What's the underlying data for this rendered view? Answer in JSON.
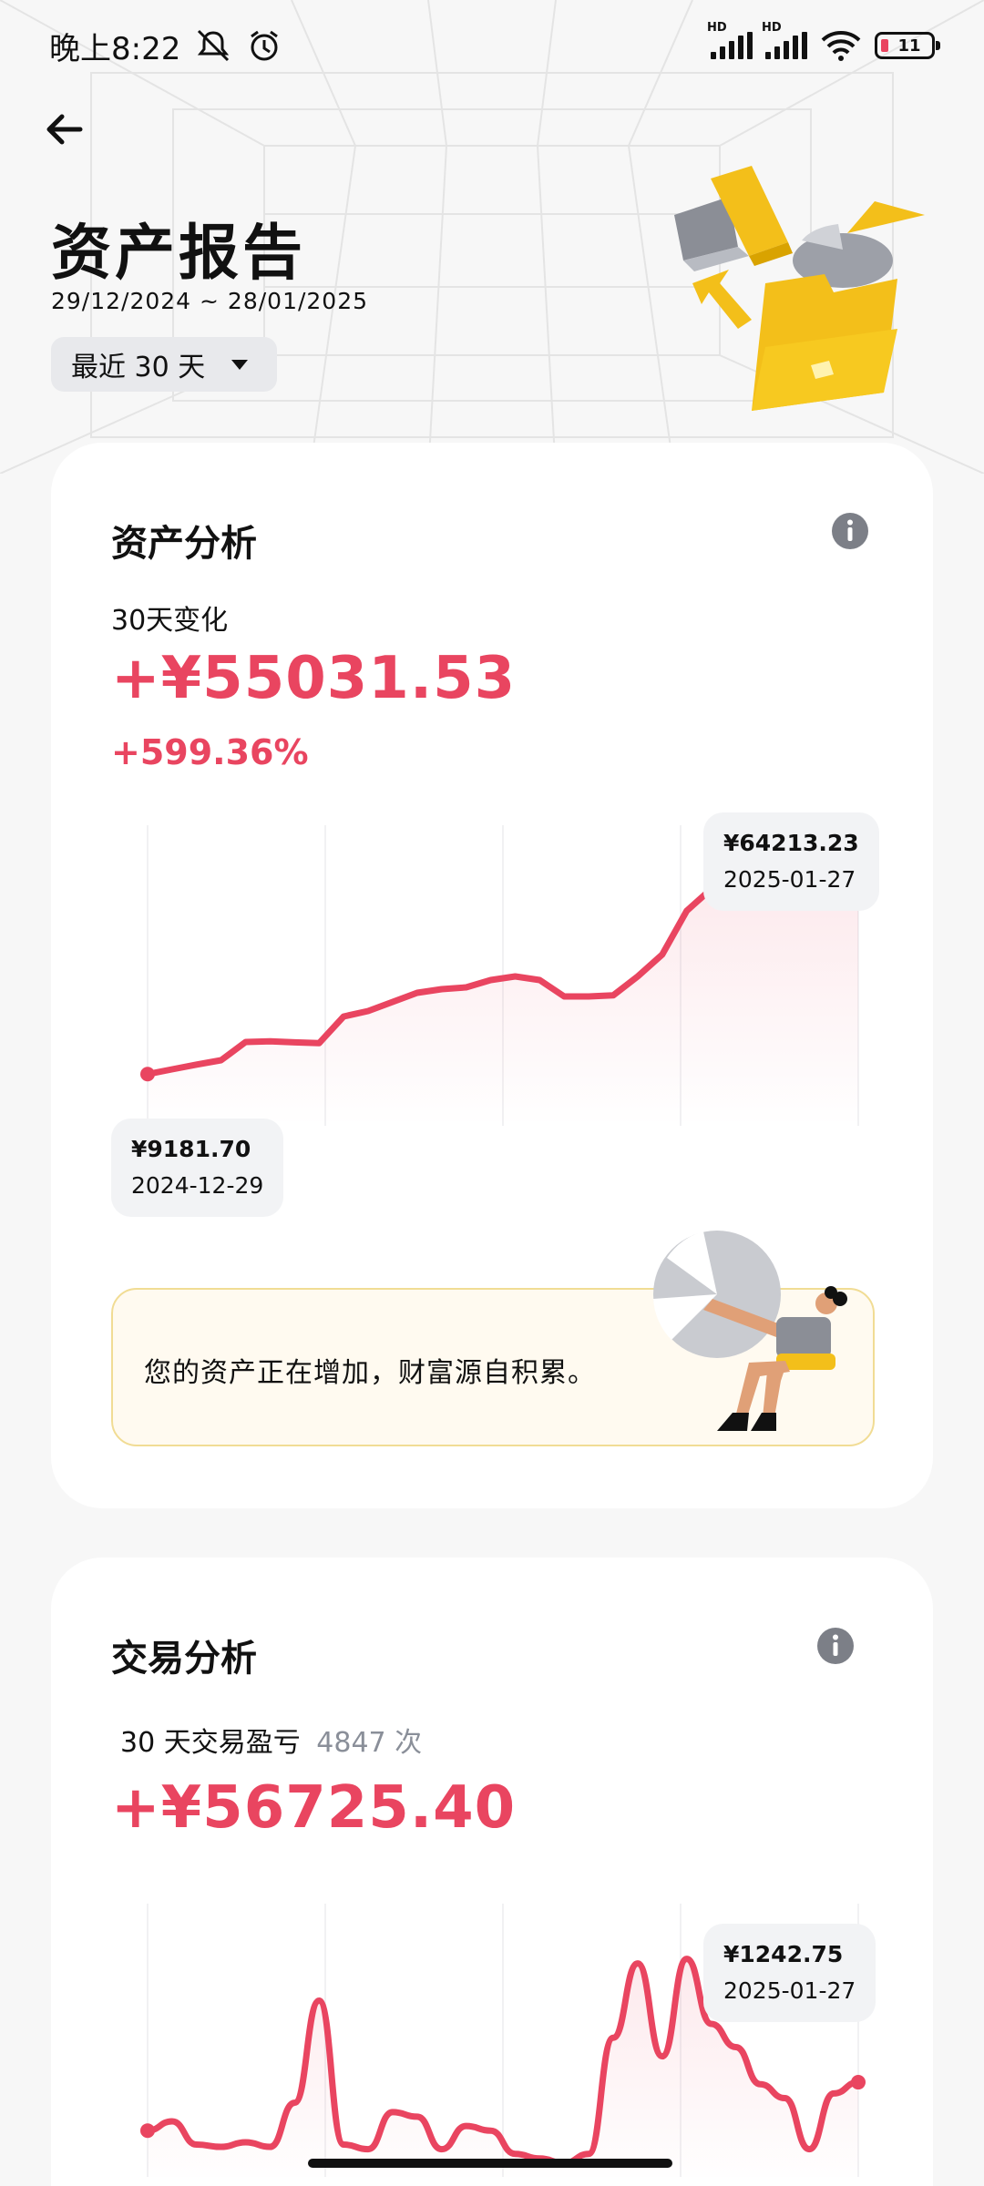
{
  "status_bar": {
    "time": "晚上8:22",
    "signal_label": "HD",
    "battery": "11",
    "icons": [
      "mute-icon",
      "alarm-icon",
      "signal-hd-icon",
      "signal-hd-icon",
      "wifi-icon",
      "battery-icon"
    ]
  },
  "header": {
    "back_icon": "arrow-left-icon",
    "title": "资产报告",
    "date_range": "29/12/2024 ~ 28/01/2025",
    "range_select": "最近 30 天"
  },
  "asset_analysis": {
    "title": "资产分析",
    "change_label": "30天变化",
    "change_value": "+¥55031.53",
    "change_pct": "+599.36%",
    "chart_start": {
      "value": "¥9181.70",
      "date": "2024-12-29"
    },
    "chart_end": {
      "value": "¥64213.23",
      "date": "2025-01-27"
    },
    "note": "您的资产正在增加，财富源自积累。"
  },
  "trade_analysis": {
    "title": "交易分析",
    "pnl_label": "30 天交易盈亏",
    "trade_count": "4847 次",
    "pnl_value": "+¥56725.40",
    "chart_end": {
      "value": "¥1242.75",
      "date": "2025-01-27"
    }
  },
  "colors": {
    "accent_red": "#e94560",
    "note_bg": "#fffaf0",
    "note_border": "#f1dc94",
    "yellow": "#f3bf1a"
  },
  "chart_data": [
    {
      "type": "area",
      "x": [
        "2024-12-29",
        "2024-12-30",
        "2024-12-31",
        "2025-01-01",
        "2025-01-02",
        "2025-01-03",
        "2025-01-04",
        "2025-01-05",
        "2025-01-06",
        "2025-01-07",
        "2025-01-08",
        "2025-01-09",
        "2025-01-10",
        "2025-01-11",
        "2025-01-12",
        "2025-01-13",
        "2025-01-14",
        "2025-01-15",
        "2025-01-16",
        "2025-01-17",
        "2025-01-18",
        "2025-01-19",
        "2025-01-20",
        "2025-01-21",
        "2025-01-22",
        "2025-01-23",
        "2025-01-24",
        "2025-01-25",
        "2025-01-26",
        "2025-01-27"
      ],
      "values": [
        9181.7,
        10500,
        11800,
        13000,
        18000,
        18200,
        17900,
        17700,
        25000,
        26500,
        29000,
        31500,
        32500,
        33000,
        35000,
        36000,
        35000,
        30500,
        30500,
        30800,
        36000,
        42000,
        54000,
        60000,
        58500,
        61000,
        62500,
        63000,
        63500,
        64213.23
      ],
      "ylim": [
        0,
        70000
      ],
      "grid": true
    },
    {
      "type": "line",
      "x": [
        "2024-12-29",
        "2024-12-30",
        "2024-12-31",
        "2025-01-01",
        "2025-01-02",
        "2025-01-03",
        "2025-01-04",
        "2025-01-05",
        "2025-01-06",
        "2025-01-07",
        "2025-01-08",
        "2025-01-09",
        "2025-01-10",
        "2025-01-11",
        "2025-01-12",
        "2025-01-13",
        "2025-01-14",
        "2025-01-15",
        "2025-01-16",
        "2025-01-17",
        "2025-01-18",
        "2025-01-19",
        "2025-01-20",
        "2025-01-21",
        "2025-01-22",
        "2025-01-23",
        "2025-01-24",
        "2025-01-25",
        "2025-01-26",
        "2025-01-27"
      ],
      "values": [
        200,
        400,
        -100,
        -150,
        -50,
        -150,
        800,
        3000,
        -100,
        -200,
        600,
        500,
        -200,
        300,
        200,
        -300,
        -400,
        -500,
        -300,
        2200,
        3800,
        1800,
        3900,
        2500,
        2000,
        1200,
        900,
        -200,
        1000,
        1242.75
      ],
      "ylim": [
        -600,
        4500
      ],
      "grid": true
    }
  ]
}
